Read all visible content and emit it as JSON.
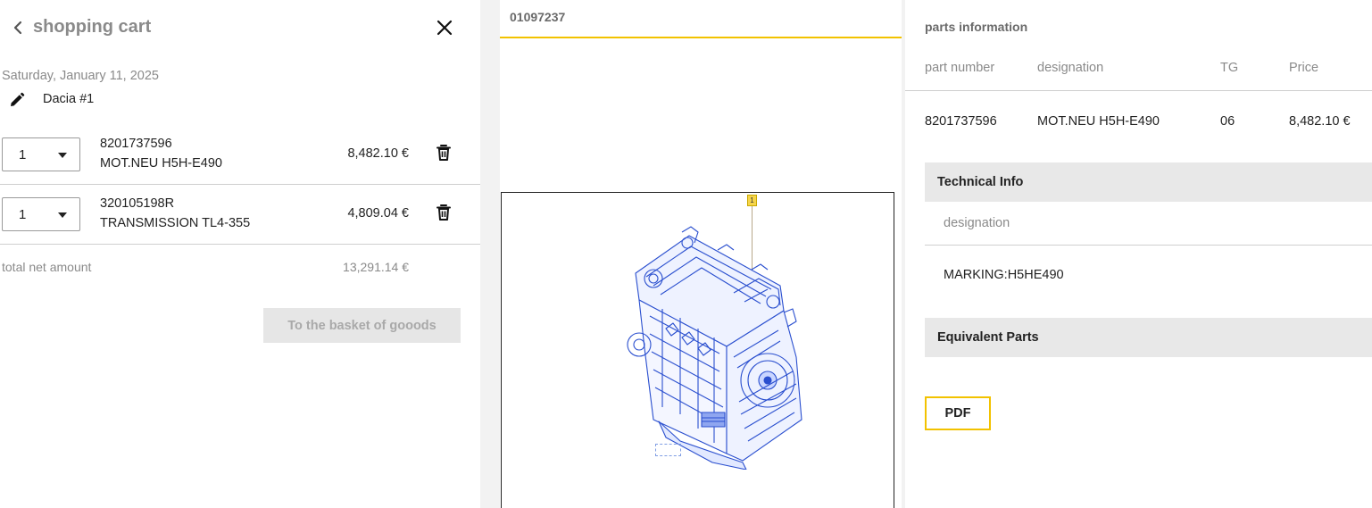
{
  "cart": {
    "title": "shopping cart",
    "date": "Saturday, January 11, 2025",
    "name": "Dacia #1",
    "items": [
      {
        "qty": "1",
        "part_number": "8201737596",
        "designation": "MOT.NEU H5H-E490",
        "price": "8,482.10 €"
      },
      {
        "qty": "1",
        "part_number": "320105198R",
        "designation": "TRANSMISSION TL4-355",
        "price": "4,809.04 €"
      }
    ],
    "total_label": "total net amount",
    "total_value": "13,291.14 €",
    "basket_button": "To the basket of gooods"
  },
  "diagram": {
    "tab_label": "01097237",
    "callout_number": "1"
  },
  "parts": {
    "title": "parts information",
    "columns": [
      "part number",
      "designation",
      "TG",
      "Price"
    ],
    "rows": [
      {
        "part_number": "8201737596",
        "designation": "MOT.NEU H5H-E490",
        "tg": "06",
        "price": "8,482.10 €"
      }
    ],
    "technical_info": {
      "header": "Technical Info",
      "sub_label": "designation",
      "value": "MARKING:H5HE490"
    },
    "equivalent_parts_header": "Equivalent Parts",
    "pdf_button": "PDF"
  },
  "colors": {
    "accent": "#f2c200",
    "muted_text": "#8a8a8a",
    "drawing_blue": "#2a4fcf",
    "section_bg": "#e8e8e8"
  },
  "icons": [
    "chevron-left-icon",
    "close-icon",
    "pencil-icon",
    "chevron-down-icon",
    "trash-icon"
  ]
}
